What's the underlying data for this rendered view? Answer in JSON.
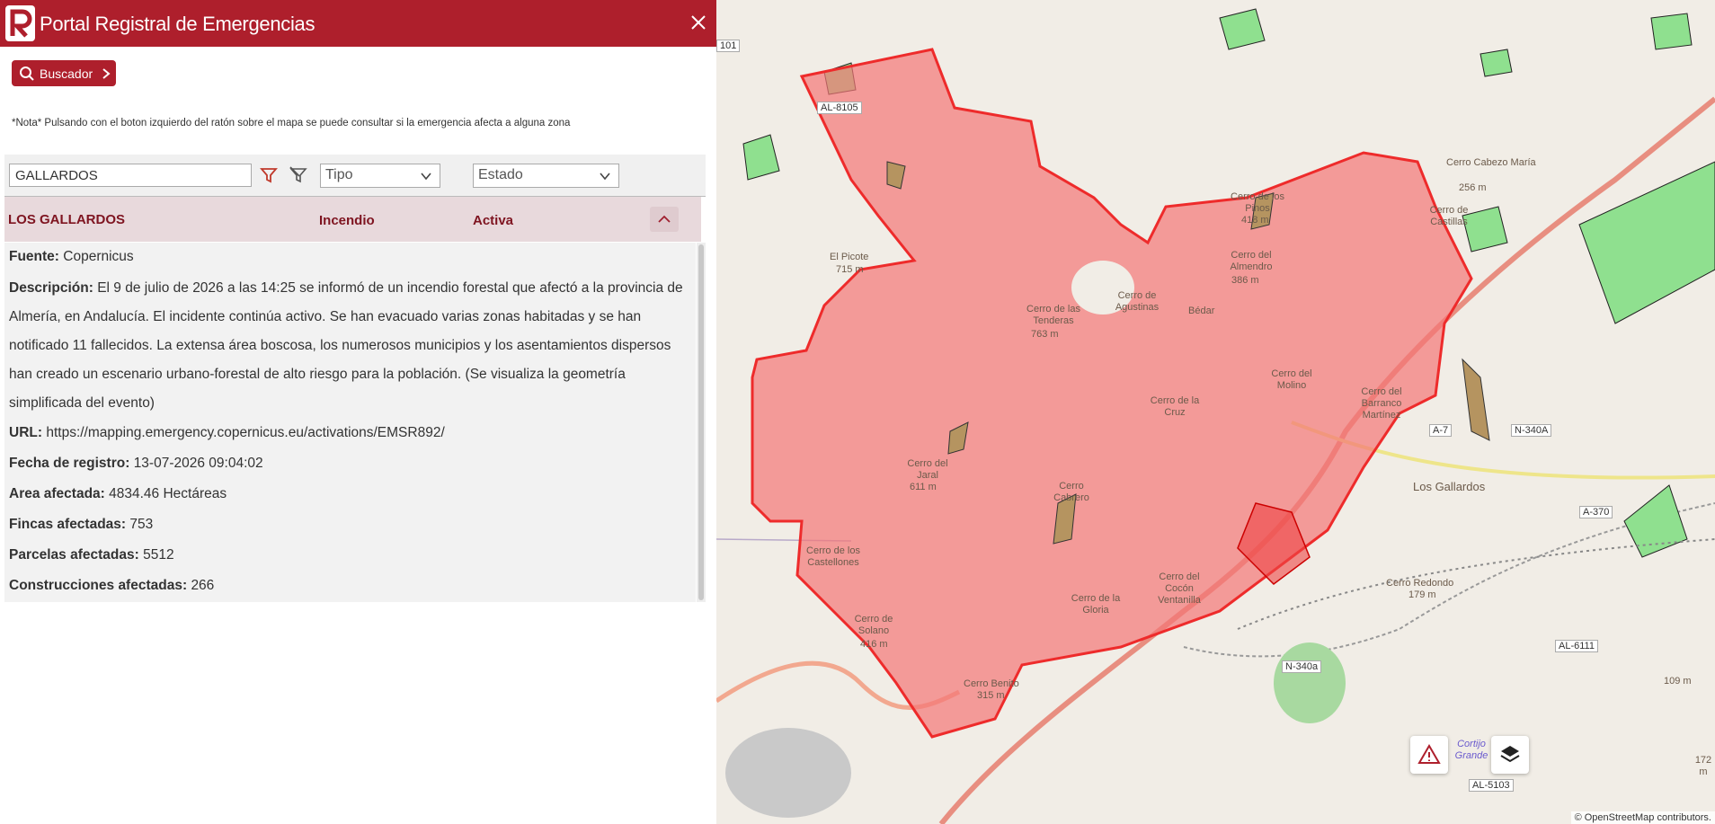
{
  "header": {
    "title": "Portal Registral de Emergencias"
  },
  "search_button": {
    "label": "Buscador"
  },
  "note": "*Nota* Pulsando con el boton izquierdo del ratón sobre el mapa se puede consultar si la emergencia afecta a alguna zona",
  "filters": {
    "name_value": "GALLARDOS",
    "tipo_placeholder": "Tipo",
    "estado_placeholder": "Estado"
  },
  "result": {
    "name": "LOS GALLARDOS",
    "type": "Incendio",
    "state": "Activa",
    "fuente_label": "Fuente:",
    "fuente_value": "Copernicus",
    "desc_label": "Descripción:",
    "desc_value": "El 9 de julio de 2026 a las 14:25 se informó de un incendio forestal que afectó a la provincia de Almería, en Andalucía. El incidente continúa activo. Se han evacuado varias zonas habitadas y se han notificado 11 fallecidos. La extensa área boscosa, los numerosos municipios y los asentamientos dispersos han creado un escenario urbano-forestal de alto riesgo para la población. (Se visualiza la geometría simplificada del evento)",
    "url_label": "URL:",
    "url_value": "https://mapping.emergency.copernicus.eu/activations/EMSR892/",
    "fecha_label": "Fecha de registro:",
    "fecha_value": "13-07-2026 09:04:02",
    "area_label": "Area afectada:",
    "area_value": "4834.46 Hectáreas",
    "fincas_label": "Fincas afectadas:",
    "fincas_value": "753",
    "parcelas_label": "Parcelas afectadas:",
    "parcelas_value": "5512",
    "construcciones_label": "Construcciones afectadas:",
    "construcciones_value": "266"
  },
  "map": {
    "labels": [
      "Cerro Cabezo María",
      "256 m",
      "Cerro de los Pinos",
      "418 m",
      "Cerro de Castillas",
      "El Picote",
      "715 m",
      "Cerro del Almendro",
      "386 m",
      "Cerro de las Tenderas",
      "763 m",
      "Cerro de Agustinas",
      "Bédar",
      "Cerro del Molino",
      "Cerro del Barranco Martínez",
      "Cerro de la Cruz",
      "Cerro Cabrero",
      "Cerro del Jaral",
      "611 m",
      "Cerro de los Castellones",
      "Cerro de Solano",
      "416 m",
      "Cerro Benito",
      "315 m",
      "Cerro de la Gloria",
      "Cerro del Cocón Ventanilla",
      "Los Gallardos",
      "Cerro Redondo",
      "179 m",
      "Cortijo Grande",
      "172 m",
      "109 m"
    ],
    "roads": [
      "A-7",
      "N-340A",
      "N-340a",
      "AL-6111",
      "AL-5103",
      "A-370",
      "101",
      "AL-8105"
    ],
    "attribution": "© OpenStreetMap contributors."
  },
  "colors": {
    "brand": "#ae1f2c",
    "burn_fill": "#f26d6d",
    "burn_stroke": "#ee2b2b"
  },
  "icons": [
    "logo-icon",
    "close-icon",
    "search-icon",
    "chevron-right-icon",
    "filter-icon",
    "clear-filter-icon",
    "chevron-down-icon",
    "chevron-up-icon",
    "warning-icon",
    "layers-icon"
  ]
}
